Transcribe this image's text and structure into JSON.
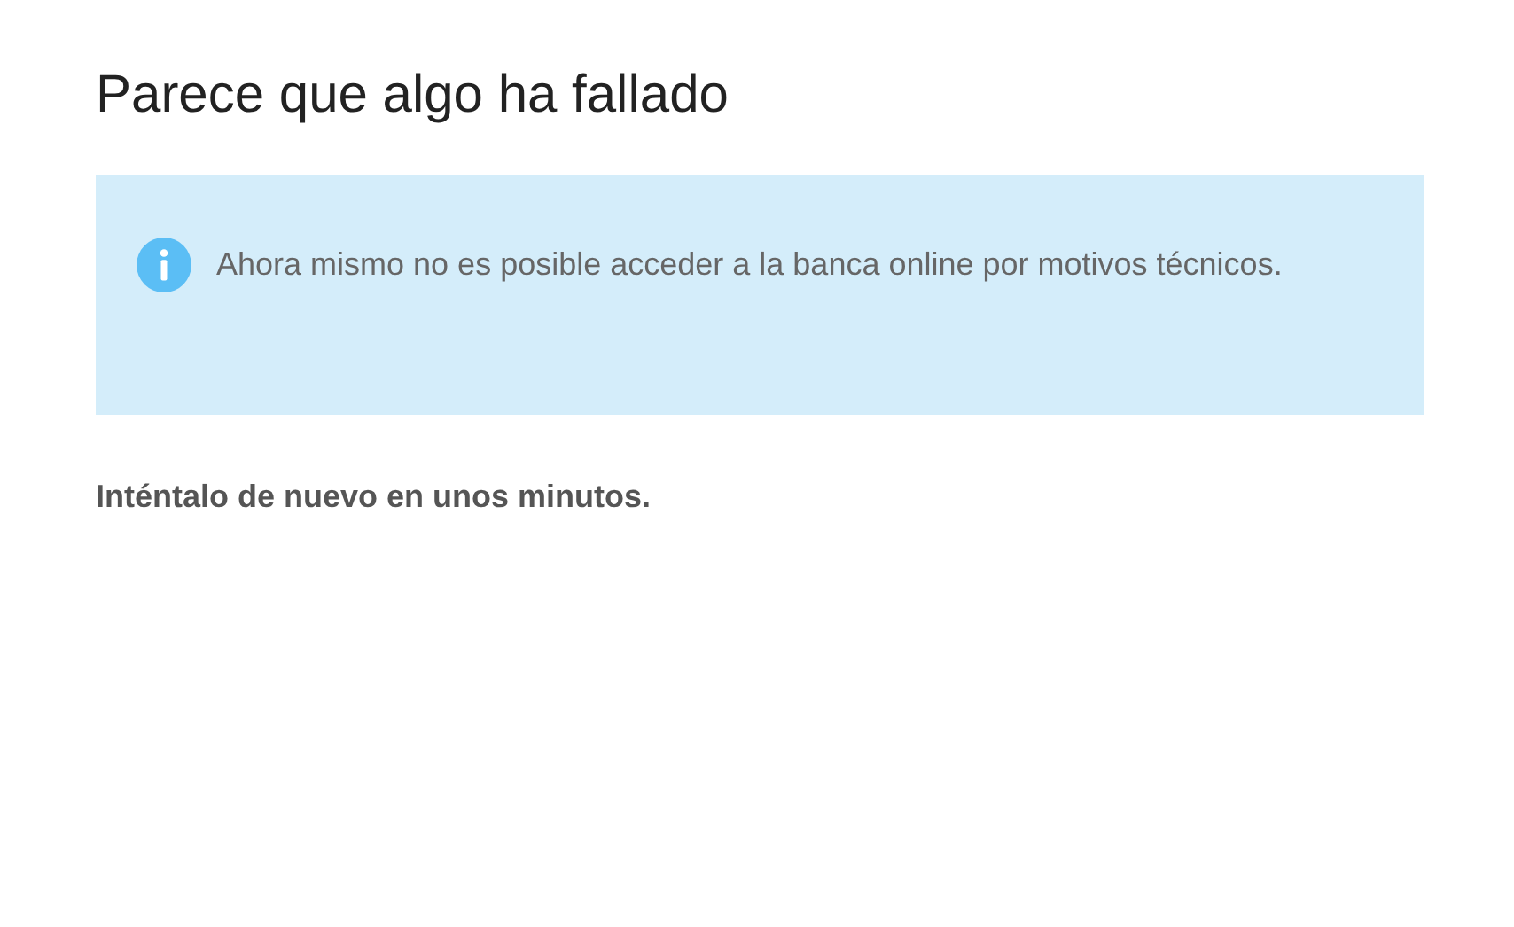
{
  "title": "Parece que algo ha fallado",
  "alert": {
    "kind": "info",
    "message": "Ahora mismo no es posible acceder a la banca online por motivos técnicos."
  },
  "hint": "Inténtalo de nuevo en unos minutos."
}
